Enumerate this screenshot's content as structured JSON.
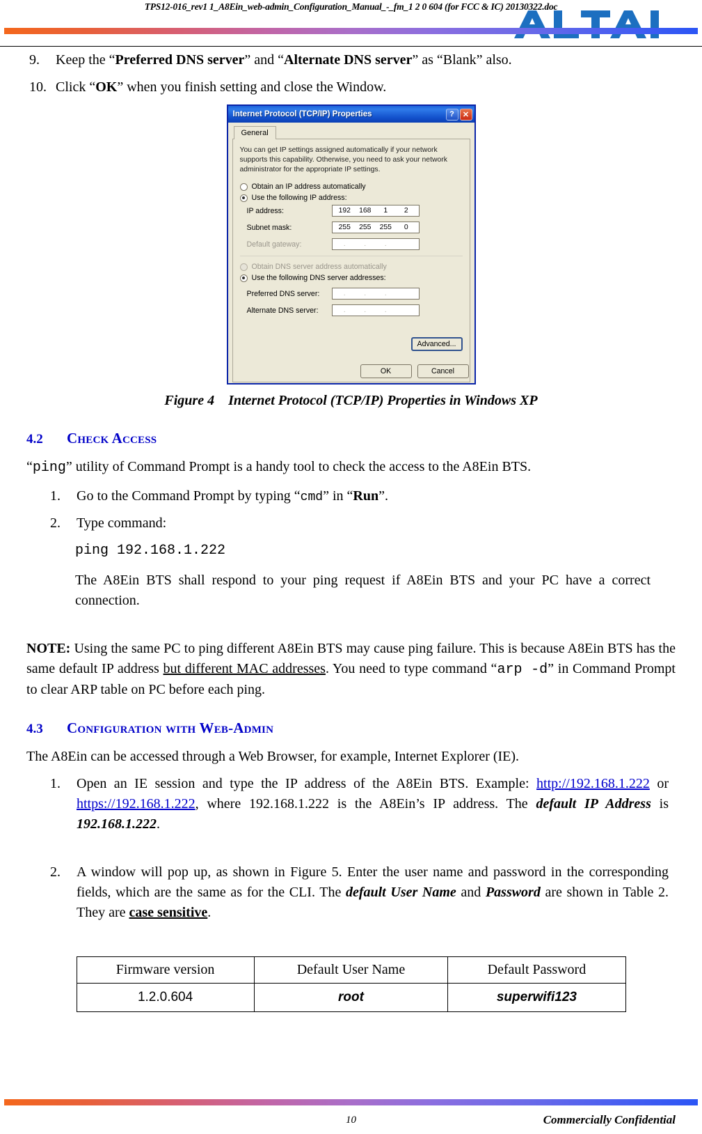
{
  "header": {
    "doc_title": "TPS12-016_rev1 1_A8Ein_web-admin_Configuration_Manual_-_fm_1 2 0 604 (for FCC & IC) 20130322.doc",
    "logo_text": "ALTAI",
    "brand_blue": "#1c6fc0",
    "gradient_start": "#f4671c",
    "gradient_end": "#2b55f5"
  },
  "steps_top": [
    {
      "number": "9.",
      "part1": "Keep the “",
      "bold1": "Preferred DNS server",
      "part2": "” and “",
      "bold2": "Alternate DNS server",
      "part3": "” as “Blank” also."
    },
    {
      "number": "10.",
      "part1": "Click “",
      "bold1": "OK",
      "part2": "” when you finish setting and close the Window."
    }
  ],
  "figure": {
    "dialog": {
      "title": "Internet Protocol (TCP/IP) Properties",
      "help_button": "?",
      "close_button": "✕",
      "tab_label": "General",
      "description": "You can get IP settings assigned automatically if your network supports this capability. Otherwise, you need to ask your network administrator for the appropriate IP settings.",
      "radio_auto_ip": "Obtain an IP address automatically",
      "radio_manual_ip": "Use the following IP address:",
      "fields": [
        {
          "label": "IP address:",
          "value": [
            "192",
            "168",
            "1",
            "2"
          ],
          "empty": false
        },
        {
          "label": "Subnet mask:",
          "value": [
            "255",
            "255",
            "255",
            "0"
          ],
          "empty": false
        },
        {
          "label": "Default gateway:",
          "value": [
            ".",
            ".",
            ".",
            ""
          ],
          "empty": true
        }
      ],
      "radio_auto_dns": "Obtain DNS server address automatically",
      "radio_manual_dns": "Use the following DNS server addresses:",
      "dns_fields": [
        {
          "label": "Preferred DNS server:",
          "value": [
            ".",
            ".",
            ".",
            ""
          ],
          "empty": true
        },
        {
          "label": "Alternate DNS server:",
          "value": [
            ".",
            ".",
            ".",
            ""
          ],
          "empty": true
        }
      ],
      "advanced_button": "Advanced...",
      "ok_button": "OK",
      "cancel_button": "Cancel"
    },
    "caption_label": "Figure 4",
    "caption_text": "Internet Protocol (TCP/IP) Properties in Windows XP"
  },
  "section_42": {
    "number": "4.2",
    "title": "Check Access",
    "intro_q1": "“",
    "intro_mono": "ping",
    "intro_rest": "” utility of Command Prompt is a handy tool to check the access to the A8Ein BTS.",
    "items": [
      {
        "number": "1.",
        "part1": "Go to the Command Prompt by typing “",
        "mono": "cmd",
        "part2": "” in “",
        "bold": "Run",
        "part3": "”."
      },
      {
        "number": "2.",
        "part1": "Type command:"
      }
    ],
    "command_line": "ping 192.168.1.222",
    "followup": "The A8Ein BTS shall respond to your ping request if A8Ein BTS and your PC have a correct connection."
  },
  "note": {
    "label": "NOTE:",
    "part1": " Using the same PC to ping different A8Ein BTS may cause ping failure.   This is because A8Ein BTS has the same default IP address ",
    "underline": "but different MAC addresses",
    "part2": ".   You need to type command “",
    "mono": "arp -d",
    "part3": "” in Command Prompt to clear ARP table on PC before each ping."
  },
  "section_43": {
    "number": "4.3",
    "title": "Configuration with Web-Admin",
    "intro": "The A8Ein can be accessed through a Web Browser, for example, Internet Explorer (IE).",
    "item1": {
      "number": "1.",
      "part1": "Open an IE session and type the IP address of the A8Ein BTS.   Example: ",
      "link1": "http://192.168.1.222",
      "part2": " or ",
      "link2": "https://192.168.1.222",
      "part3": ", where 192.168.1.222 is the A8Ein’s IP address.   The ",
      "bolditalic": "default IP Address",
      "part4": " is ",
      "bolditalic2": "192.168.1.222",
      "part5": "."
    },
    "item2": {
      "number": "2.",
      "part1": "A window will pop up, as shown in Figure 5.   Enter the user name and password in the corresponding fields, which are the same as for the CLI.   The ",
      "bolditalic": "default User Name",
      "part2": " and ",
      "bolditalic2": "Password",
      "part3": " are shown in Table 2.   They are ",
      "underline": "case sensitive",
      "part4": "."
    }
  },
  "table": {
    "headers": [
      "Firmware version",
      "Default User Name",
      "Default Password"
    ],
    "rows": [
      [
        "1.2.0.604",
        "root",
        "superwifi123"
      ]
    ]
  },
  "footer": {
    "page_number": "10",
    "confidential": "Commercially Confidential"
  }
}
